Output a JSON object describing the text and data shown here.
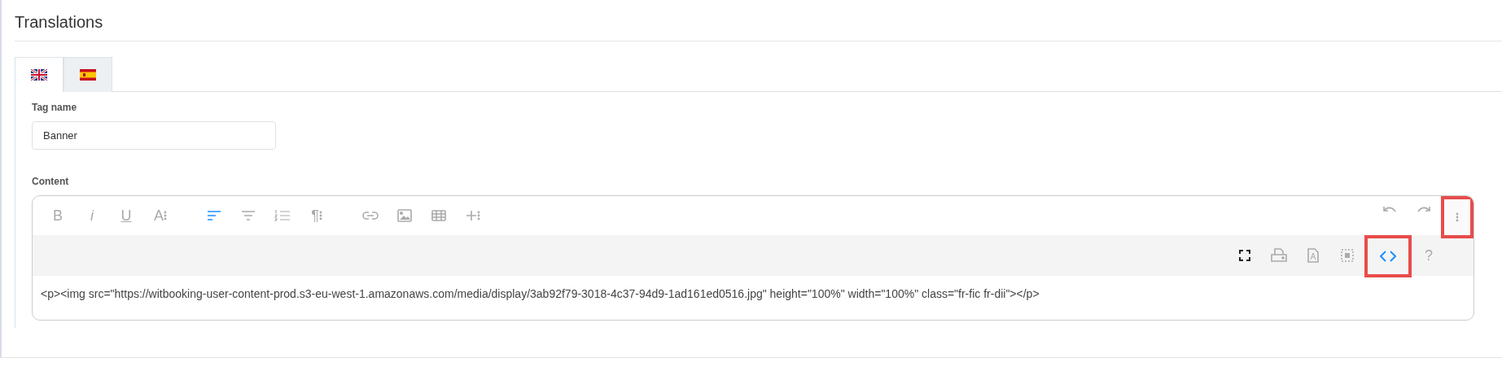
{
  "section_title": "Translations",
  "tabs": [
    {
      "kind": "uk",
      "selected": true
    },
    {
      "kind": "es",
      "selected": false
    }
  ],
  "fields": {
    "tag_name": {
      "label": "Tag name",
      "value": "Banner"
    },
    "content": {
      "label": "Content"
    }
  },
  "toolbar": {
    "groups": [
      [
        {
          "kind": "bold",
          "glyph": "B",
          "active": false
        },
        {
          "kind": "italic",
          "glyph": "i",
          "active": false
        },
        {
          "kind": "underline",
          "glyph": "U",
          "active": false
        },
        {
          "kind": "font",
          "glyph": "A",
          "active": false
        }
      ],
      [
        {
          "kind": "align",
          "active": true
        },
        {
          "kind": "paragraph-format",
          "active": false
        },
        {
          "kind": "ordered-list",
          "active": false
        },
        {
          "kind": "paragraph",
          "glyph": "¶",
          "active": false
        }
      ],
      [
        {
          "kind": "link",
          "active": false
        },
        {
          "kind": "image",
          "active": false
        },
        {
          "kind": "table",
          "active": false
        },
        {
          "kind": "insert",
          "active": false
        }
      ]
    ],
    "right": [
      {
        "kind": "undo",
        "active": false,
        "highlighted": false
      },
      {
        "kind": "redo",
        "active": false,
        "highlighted": false
      },
      {
        "kind": "more",
        "active": false,
        "highlighted": true
      }
    ]
  },
  "secondary_toolbar": [
    {
      "kind": "fullscreen",
      "active": false,
      "highlighted": false
    },
    {
      "kind": "print",
      "active": false,
      "highlighted": false
    },
    {
      "kind": "pdf",
      "active": false,
      "highlighted": false
    },
    {
      "kind": "select-all",
      "active": false,
      "highlighted": false
    },
    {
      "kind": "code-view",
      "active": true,
      "highlighted": true
    },
    {
      "kind": "help",
      "glyph": "?",
      "active": false,
      "highlighted": false
    }
  ],
  "editor_text": "<p><img src=\"https://witbooking-user-content-prod.s3-eu-west-1.amazonaws.com/media/display/3ab92f79-3018-4c37-94d9-1ad161ed0516.jpg\" height=\"100%\" width=\"100%\" class=\"fr-fic fr-dii\"></p>"
}
